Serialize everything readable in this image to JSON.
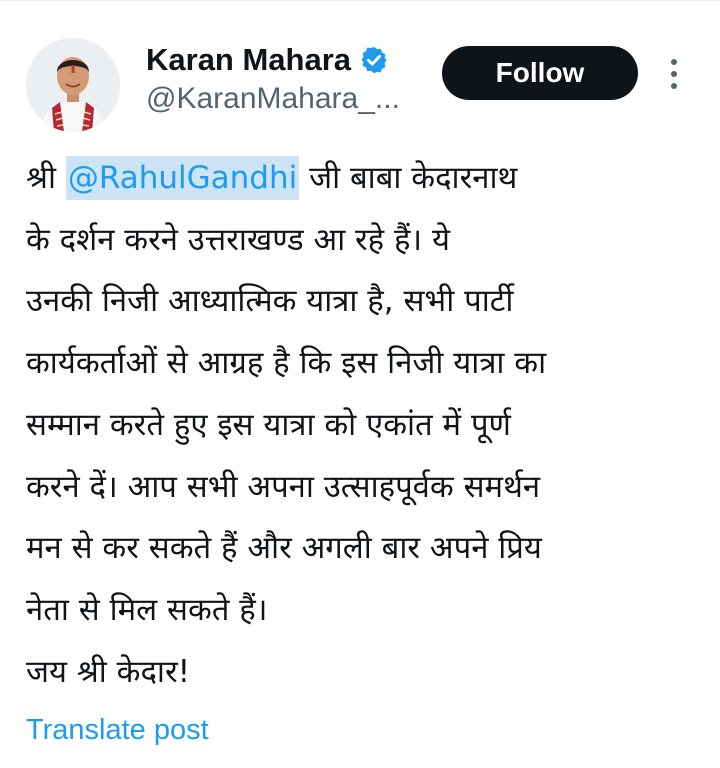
{
  "author": {
    "display_name": "Karan Mahara",
    "handle": "@KaranMahara_...",
    "verified": true
  },
  "actions": {
    "follow_label": "Follow",
    "more_icon": "more-vertical-icon"
  },
  "post": {
    "line1_prefix": "श्री ",
    "mention": "@RahulGandhi",
    "line1_suffix": " जी बाबा केदारनाथ",
    "lines": [
      "के दर्शन करने उत्तराखण्ड आ रहे हैं। ये",
      "उनकी निजी आध्यात्मिक यात्रा है, सभी पार्टी",
      "कार्यकर्ताओं से आग्रह है कि इस निजी यात्रा का",
      "सम्मान करते हुए इस यात्रा को एकांत में पूर्ण",
      "करने दें। आप सभी अपना उत्साहपूर्वक समर्थन",
      "मन से कर सकते हैं और अगली बार अपने प्रिय",
      "नेता से मिल सकते हैं।",
      "जय श्री केदार!"
    ]
  },
  "translate_label": "Translate post",
  "colors": {
    "accent": "#1d9bf0",
    "mention_highlight": "#cde4f7",
    "text": "#0f1419",
    "secondary_text": "#536471",
    "follow_bg": "#0f1419",
    "verified_badge": "#1d9bf0"
  }
}
